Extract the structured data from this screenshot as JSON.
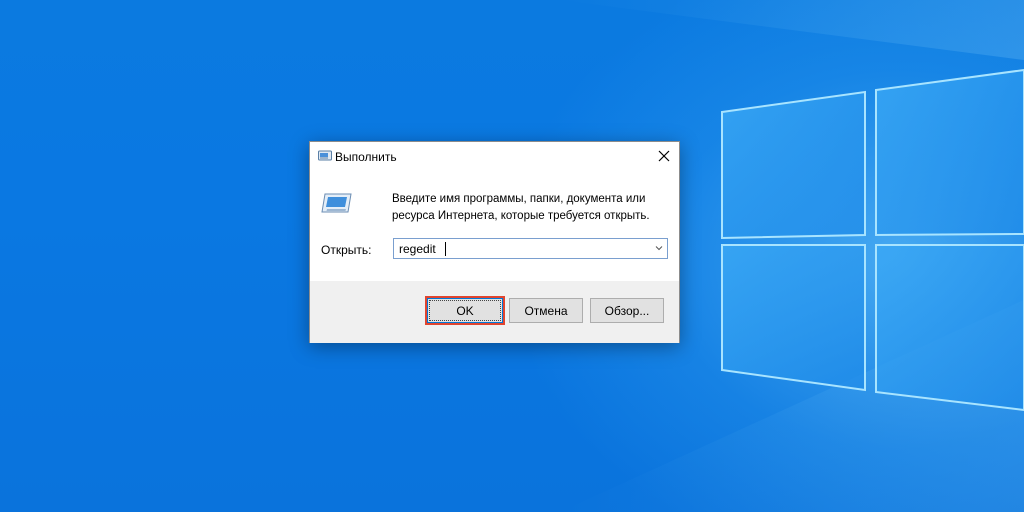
{
  "dialog": {
    "title": "Выполнить",
    "description": "Введите имя программы, папки, документа или ресурса Интернета, которые требуется открыть.",
    "open_label": "Открыть:",
    "open_value": "regedit",
    "buttons": {
      "ok": "OK",
      "cancel": "Отмена",
      "browse": "Обзор..."
    }
  },
  "icons": {
    "title_icon": "run-icon",
    "body_icon": "run-icon",
    "close_icon": "close-icon",
    "dropdown_icon": "chevron-down-icon",
    "wallpaper_logo": "windows-logo"
  },
  "colors": {
    "desktop_blue": "#0a78e2",
    "highlight_border": "#e0452f",
    "focus_blue": "#0078d7"
  }
}
